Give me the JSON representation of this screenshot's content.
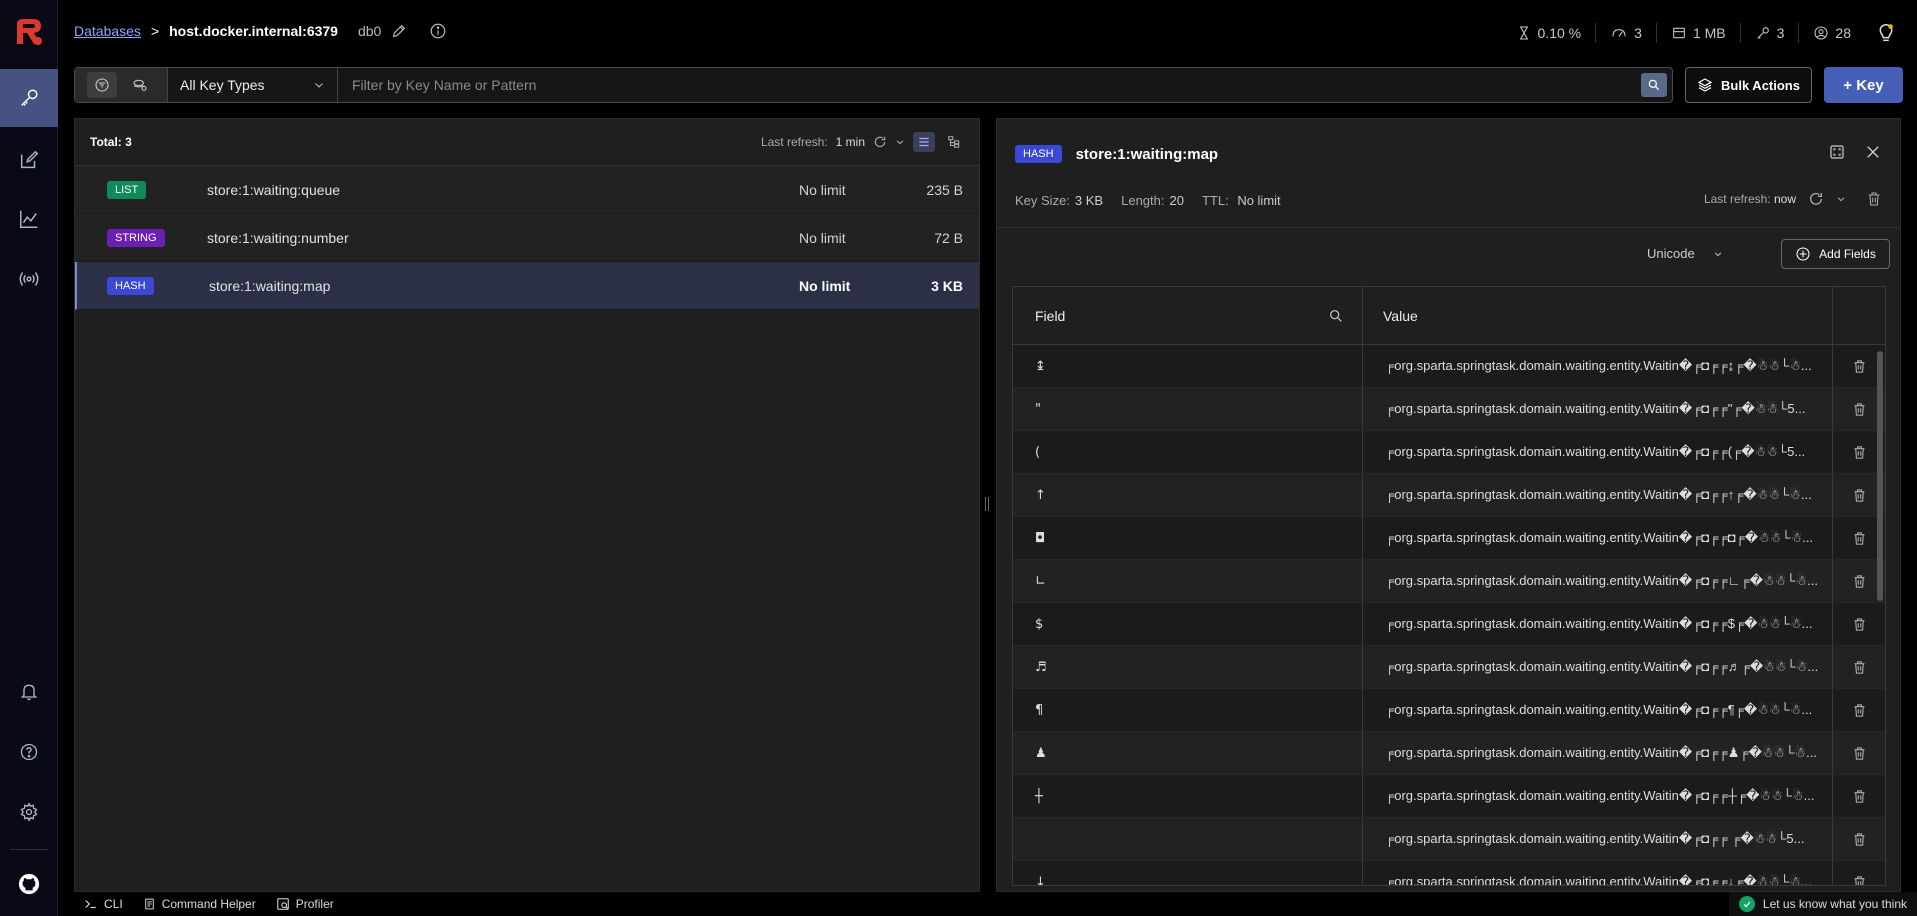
{
  "colors": {
    "accent": "#465fb6",
    "list_badge": "#0f8a5b",
    "string_badge": "#6b1fb4",
    "hash_badge": "#3b48d6",
    "sidebar_active": "#465282",
    "logo": "#dc382d"
  },
  "breadcrumb": {
    "databases": "Databases",
    "separator": ">",
    "host": "host.docker.internal:6379",
    "db": "db0"
  },
  "stats": {
    "cpu": "0.10 %",
    "ops": "3",
    "memory": "1 MB",
    "keys": "3",
    "clients": "28"
  },
  "filter": {
    "type": "All Key Types",
    "placeholder": "Filter by Key Name or Pattern"
  },
  "buttons": {
    "bulk_actions": "Bulk Actions",
    "add_key": "+ Key",
    "add_fields": "Add Fields"
  },
  "key_list": {
    "total": "Total: 3",
    "refresh_label": "Last refresh:",
    "refresh_value": "1 min",
    "keys": [
      {
        "type": "LIST",
        "name": "store:1:waiting:queue",
        "ttl": "No limit",
        "size": "235 B"
      },
      {
        "type": "STRING",
        "name": "store:1:waiting:number",
        "ttl": "No limit",
        "size": "72 B"
      },
      {
        "type": "HASH",
        "name": "store:1:waiting:map",
        "ttl": "No limit",
        "size": "3 KB"
      }
    ]
  },
  "detail": {
    "type": "HASH",
    "key": "store:1:waiting:map",
    "size_label": "Key Size:",
    "size_value": "3 KB",
    "length_label": "Length:",
    "length_value": "20",
    "ttl_label": "TTL:",
    "ttl_value": "No limit",
    "refresh_label": "Last refresh:",
    "refresh_value": "now",
    "encoding": "Unicode",
    "columns": {
      "field": "Field",
      "value": "Value"
    },
    "rows": [
      {
        "field": "↨",
        "value": "╒org.sparta.springtask.domain.waiting.entity.Waitin�╒◘╒╒↨╒�☃☃└☃..."
      },
      {
        "field": "\"",
        "value": "╒org.sparta.springtask.domain.waiting.entity.Waitin�╒◘╒╒\"╒�☃☃└5..."
      },
      {
        "field": "(",
        "value": "╒org.sparta.springtask.domain.waiting.entity.Waitin�╒◘╒╒(╒�☃☃└5..."
      },
      {
        "field": "↑",
        "value": "╒org.sparta.springtask.domain.waiting.entity.Waitin�╒◘╒╒↑╒�☃☃└☃..."
      },
      {
        "field": "◘",
        "value": "╒org.sparta.springtask.domain.waiting.entity.Waitin�╒◘╒╒◘╒�☃☃└☃..."
      },
      {
        "field": "∟",
        "value": "╒org.sparta.springtask.domain.waiting.entity.Waitin�╒◘╒╒∟╒�☃☃└☃..."
      },
      {
        "field": "$",
        "value": "╒org.sparta.springtask.domain.waiting.entity.Waitin�╒◘╒╒$╒�☃☃└☃..."
      },
      {
        "field": "♬",
        "value": "╒org.sparta.springtask.domain.waiting.entity.Waitin�╒◘╒╒♬╒�☃☃└☃..."
      },
      {
        "field": "¶",
        "value": "╒org.sparta.springtask.domain.waiting.entity.Waitin�╒◘╒╒¶╒�☃☃└☃..."
      },
      {
        "field": "♟",
        "value": "╒org.sparta.springtask.domain.waiting.entity.Waitin�╒◘╒╒♟╒�☃☃└☃..."
      },
      {
        "field": "┼",
        "value": "╒org.sparta.springtask.domain.waiting.entity.Waitin�╒◘╒╒┼╒�☃☃└☃..."
      },
      {
        "field": "",
        "value": "╒org.sparta.springtask.domain.waiting.entity.Waitin�╒◘╒╒ ╒�☃☃└5..."
      },
      {
        "field": "↓",
        "value": "╒org.sparta.springtask.domain.waiting.entity.Waitin�╒◘╒╒↓╒�☃☃└☃..."
      }
    ]
  },
  "bottom": {
    "cli": "CLI",
    "command_helper": "Command Helper",
    "profiler": "Profiler",
    "feedback": "Let us know what you think"
  }
}
